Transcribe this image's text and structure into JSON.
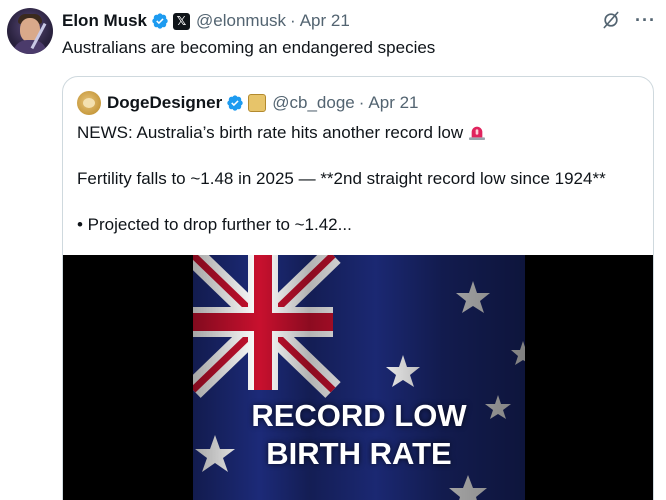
{
  "author": {
    "name": "Elon Musk",
    "handle": "@elonmusk",
    "date_sep": "·",
    "date": "Apr 21",
    "badge_icon": "verified-badge-icon",
    "affiliate_icon": "x-logo-icon"
  },
  "tweet": {
    "text": "Australians are becoming an endangered species"
  },
  "quote": {
    "name": "DogeDesigner",
    "handle": "@cb_doge",
    "date_sep": "·",
    "date": "Apr 21",
    "line1": "NEWS: Australia’s birth rate hits another record low",
    "line2": "Fertility falls to ~1.48 in 2025 — **2nd straight record low since 1924**",
    "line3": "• Projected to drop further to ~1.42...",
    "media_overlay_line1": "RECORD LOW",
    "media_overlay_line2": "BIRTH RATE"
  },
  "icons": {
    "grok": "grok-icon",
    "more": "more-options-icon",
    "siren": "siren-emoji-icon"
  },
  "colors": {
    "verified_blue": "#1d9bf0",
    "muted_text": "#536471",
    "border": "#cfd9de",
    "flag_blue": "#1c2a78",
    "flag_red": "#c8102e"
  }
}
